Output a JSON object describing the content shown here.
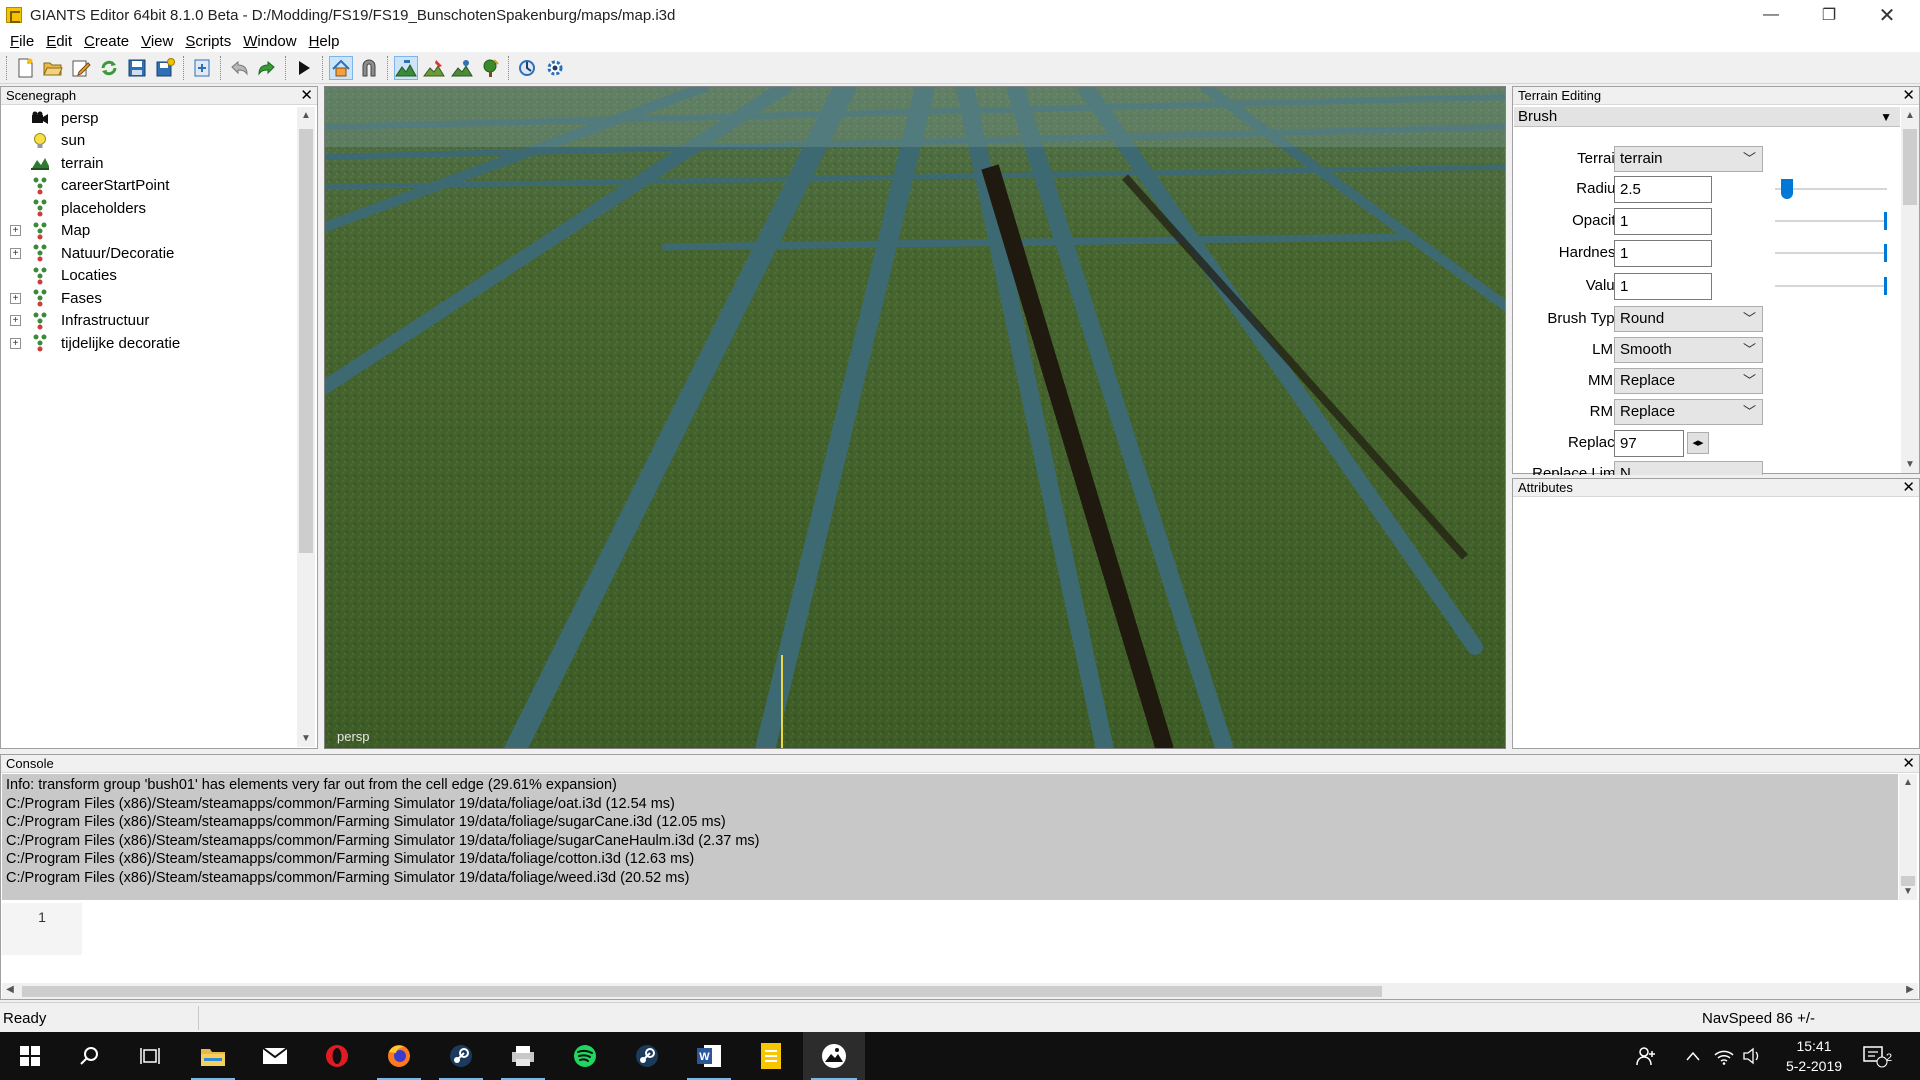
{
  "window": {
    "title": "GIANTS Editor 64bit 8.1.0 Beta - D:/Modding/FS19/FS19_BunschotenSpakenburg/maps/map.i3d",
    "minimize_glyph": "—",
    "maximize_glyph": "❐",
    "close_glyph": "✕"
  },
  "menu": [
    {
      "u": "F",
      "rest": "ile"
    },
    {
      "u": "E",
      "rest": "dit"
    },
    {
      "u": "C",
      "rest": "reate"
    },
    {
      "u": "V",
      "rest": "iew"
    },
    {
      "u": "S",
      "rest": "cripts"
    },
    {
      "u": "W",
      "rest": "indow"
    },
    {
      "u": "H",
      "rest": "elp"
    }
  ],
  "toolbar": {
    "icons": [
      "new-file-icon",
      "open-file-icon",
      "edit-file-icon",
      "reload-icon",
      "save-icon",
      "save-as-icon",
      "export-icon",
      "undo-icon",
      "redo-icon",
      "play-icon",
      "terrain-select-icon",
      "magnet-icon",
      "terrain-sculpt-icon",
      "paint-texture-icon",
      "foliage-paint-icon",
      "tree-paint-icon",
      "rotate-scene-icon",
      "settings-icon"
    ]
  },
  "scenegraph": {
    "title": "Scenegraph",
    "items": [
      {
        "label": "persp",
        "icon": "camera-icon",
        "expandable": false
      },
      {
        "label": "sun",
        "icon": "light-bulb-icon",
        "expandable": false
      },
      {
        "label": "terrain",
        "icon": "terrain-icon",
        "expandable": false
      },
      {
        "label": "careerStartPoint",
        "icon": "transform-group-icon",
        "expandable": false
      },
      {
        "label": "placeholders",
        "icon": "transform-group-icon",
        "expandable": false
      },
      {
        "label": "Map",
        "icon": "transform-group-icon",
        "expandable": true
      },
      {
        "label": "Natuur/Decoratie",
        "icon": "transform-group-icon",
        "expandable": true
      },
      {
        "label": "Locaties",
        "icon": "transform-group-icon",
        "expandable": false
      },
      {
        "label": "Fases",
        "icon": "transform-group-icon",
        "expandable": true
      },
      {
        "label": "Infrastructuur",
        "icon": "transform-group-icon",
        "expandable": true
      },
      {
        "label": "tijdelijke decoratie",
        "icon": "transform-group-icon",
        "expandable": true
      }
    ]
  },
  "viewport": {
    "camera_label": "persp"
  },
  "terrain_editing": {
    "title": "Terrain Editing",
    "section": "Brush",
    "fields": {
      "terrain": {
        "label": "Terrain",
        "value": "terrain"
      },
      "radius": {
        "label": "Radius",
        "value": "2.5"
      },
      "opacity": {
        "label": "Opacity",
        "value": "1"
      },
      "hardness": {
        "label": "Hardness",
        "value": "1"
      },
      "value": {
        "label": "Value",
        "value": "1"
      },
      "brush_type": {
        "label": "Brush Type",
        "value": "Round"
      },
      "lmb": {
        "label": "LMB",
        "value": "Smooth"
      },
      "mmb": {
        "label": "MMB",
        "value": "Replace"
      },
      "rmb": {
        "label": "RMB",
        "value": "Replace"
      },
      "replace": {
        "label": "Replace",
        "value": "97"
      },
      "replace_limit": {
        "label": "Replace Limit",
        "value": "N..."
      }
    }
  },
  "attributes": {
    "title": "Attributes"
  },
  "console": {
    "title": "Console",
    "lines": [
      "Info: transform group 'bush01' has elements very far out from the cell edge (29.61% expansion)",
      "C:/Program Files (x86)/Steam/steamapps/common/Farming Simulator 19/data/foliage/oat.i3d (12.54 ms)",
      "C:/Program Files (x86)/Steam/steamapps/common/Farming Simulator 19/data/foliage/sugarCane.i3d (12.05 ms)",
      "C:/Program Files (x86)/Steam/steamapps/common/Farming Simulator 19/data/foliage/sugarCaneHaulm.i3d (2.37 ms)",
      "C:/Program Files (x86)/Steam/steamapps/common/Farming Simulator 19/data/foliage/cotton.i3d (12.63 ms)",
      "C:/Program Files (x86)/Steam/steamapps/common/Farming Simulator 19/data/foliage/weed.i3d (20.52 ms)"
    ],
    "line_number": "1"
  },
  "status": {
    "text": "Ready",
    "navspeed": "NavSpeed 86 +/-"
  },
  "taskbar": {
    "apps": [
      "windows-start-icon",
      "search-icon",
      "task-view-icon",
      "file-explorer-icon",
      "mail-icon",
      "opera-icon",
      "firefox-icon",
      "steam-icon",
      "printer-icon",
      "spotify-icon",
      "steam-icon",
      "word-icon",
      "notes-icon",
      "giants-editor-icon"
    ],
    "time": "15:41",
    "date": "5-2-2019",
    "notification_count": "2"
  },
  "colors": {
    "accent": "#0078d7",
    "field_green": "#3f5a26",
    "ditch_water": "#3d6a72"
  }
}
